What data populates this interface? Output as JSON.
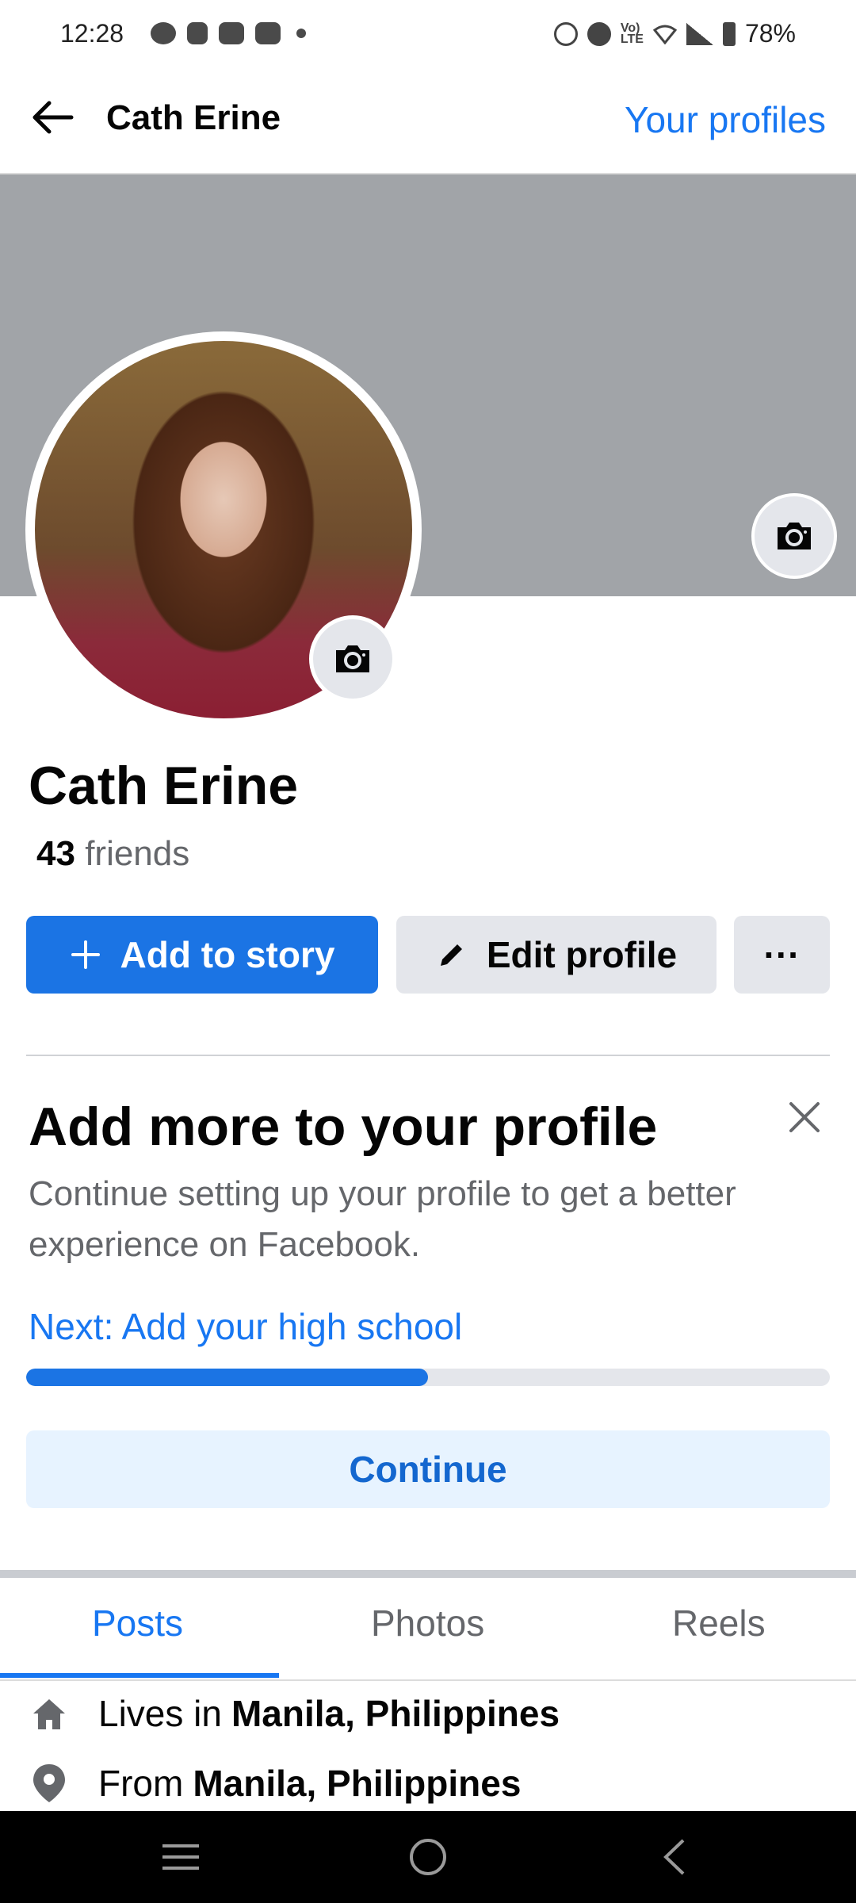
{
  "status_bar": {
    "time": "12:28",
    "battery": "78%",
    "left_icons": [
      "messenger-icon",
      "shopee-icon",
      "youtube-icon",
      "youtube-icon",
      "dot-icon"
    ],
    "right_icons": [
      "alarm-icon",
      "dnd-icon",
      "volte-icon",
      "wifi-icon",
      "signal-icon",
      "battery-icon"
    ]
  },
  "header": {
    "title": "Cath Erine",
    "right_link": "Your profiles"
  },
  "profile": {
    "name": "Cath Erine",
    "friends_count": "43",
    "friends_label": "friends"
  },
  "actions": {
    "add_story": "Add to story",
    "edit_profile": "Edit profile",
    "more": "···"
  },
  "card": {
    "title": "Add more to your profile",
    "description": "Continue setting up your profile to get a better experience on Facebook.",
    "next": "Next: Add your high school",
    "progress": 0.5,
    "continue": "Continue"
  },
  "tabs": [
    "Posts",
    "Photos",
    "Reels"
  ],
  "info": {
    "lives_prefix": "Lives in",
    "lives_value": "Manila, Philippines",
    "from_prefix": "From",
    "from_value": "Manila, Philippines"
  },
  "colors": {
    "accent": "#1877f2",
    "button_blue": "#1b74e4",
    "cover_gray": "#a1a4a8"
  }
}
